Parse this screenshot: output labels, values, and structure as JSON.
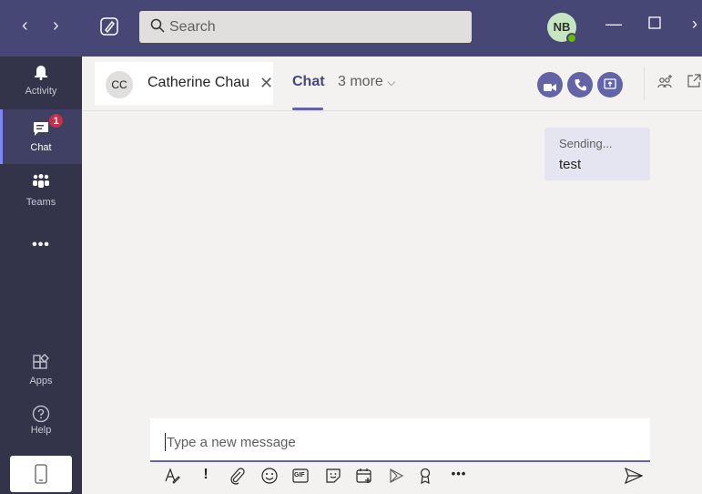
{
  "topbar": {
    "back_icon": "chevron-left",
    "forward_icon": "chevron-right",
    "compose_icon": "compose",
    "search_placeholder": "Search",
    "user_initials": "NB",
    "presence_color": "#6bb700",
    "accent": "#464775"
  },
  "rail": {
    "items": [
      {
        "label": "Activity",
        "icon": "bell"
      },
      {
        "label": "Chat",
        "icon": "chat",
        "badge": "1"
      },
      {
        "label": "Teams",
        "icon": "people"
      },
      {
        "label": "Apps",
        "icon": "apps"
      },
      {
        "label": "Help",
        "icon": "question"
      }
    ],
    "more": "•••"
  },
  "chat_header": {
    "contact_initials": "CC",
    "contact_name": "Catherine Chau",
    "tab_chat": "Chat",
    "tab_more": "3 more"
  },
  "messages": [
    {
      "status": "Sending...",
      "text": "test"
    }
  ],
  "composer": {
    "placeholder": "Type a new message",
    "toolbar": [
      "format",
      "important",
      "attach",
      "emoji",
      "gif",
      "sticker",
      "schedule-meeting",
      "stream",
      "praise",
      "more"
    ],
    "gif_label": "GIF",
    "more_label": "•••"
  }
}
